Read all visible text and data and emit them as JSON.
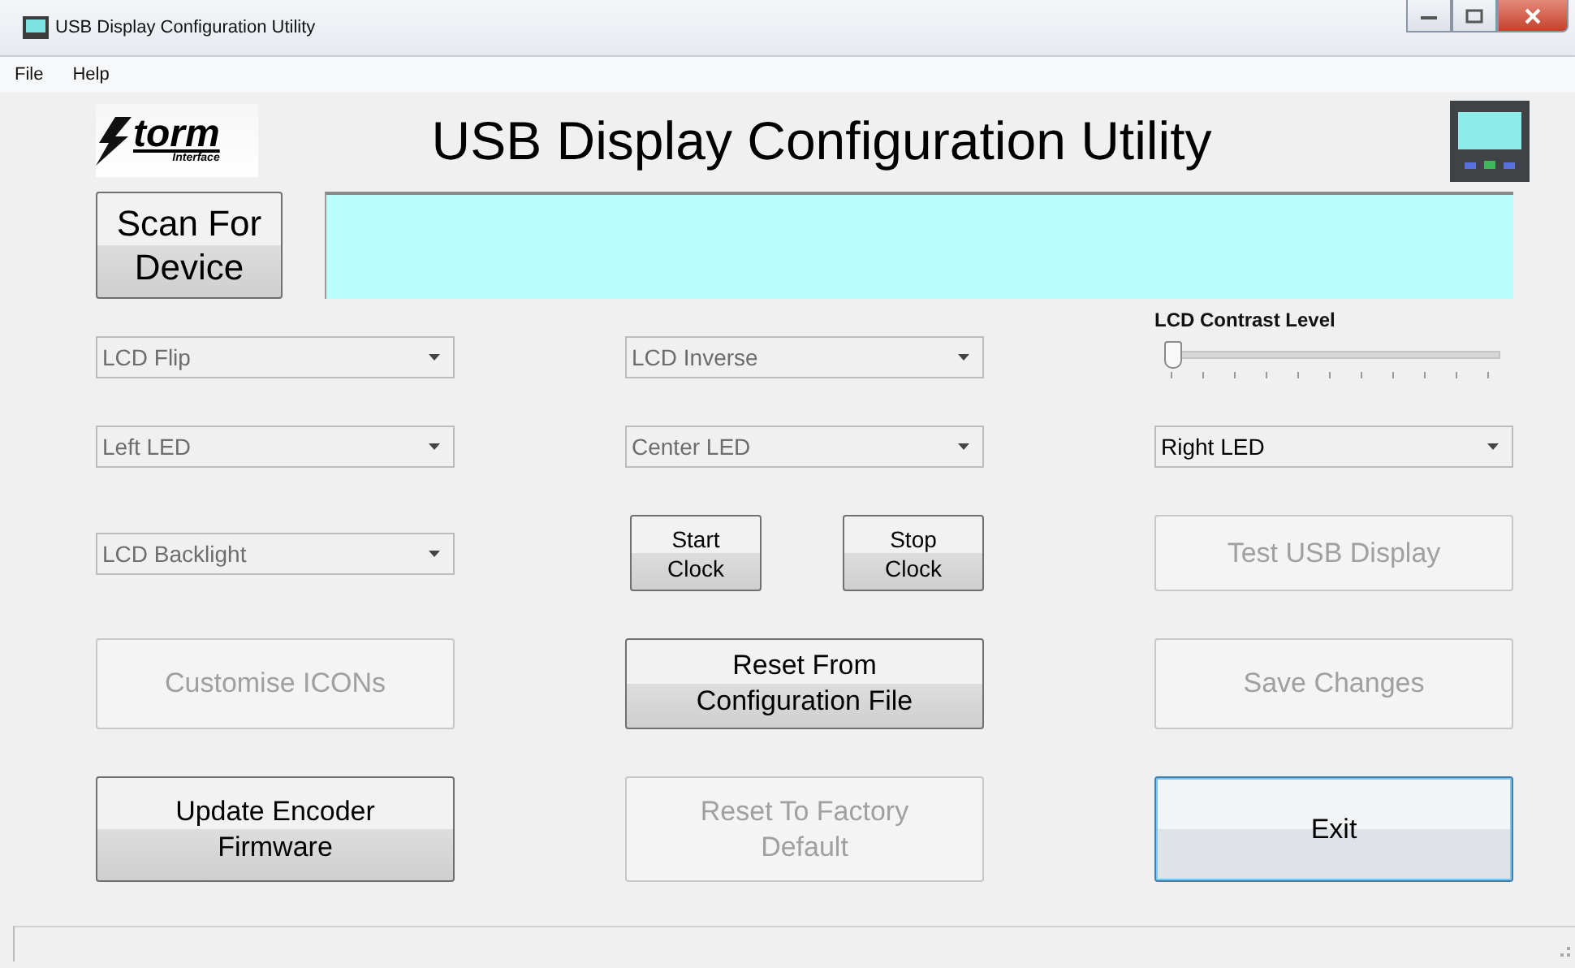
{
  "window": {
    "title": "USB Display Configuration Utility"
  },
  "menu": [
    "File",
    "Help"
  ],
  "header": {
    "logo_text": "torm",
    "logo_subtext": "Interface",
    "title": "USB Display Configuration Utility"
  },
  "scan_button": {
    "label": "Scan For Device"
  },
  "rows": [
    [
      {
        "kind": "dropdown",
        "label": "LCD Flip",
        "disabled": true
      },
      {
        "kind": "dropdown",
        "label": "LCD Inverse",
        "disabled": true
      },
      {
        "kind": "slider",
        "label": "LCD Contrast Level",
        "level": 0
      }
    ],
    [
      {
        "kind": "dropdown",
        "label": "Left LED",
        "disabled": true
      },
      {
        "kind": "dropdown",
        "label": "Center LED",
        "disabled": true
      },
      {
        "kind": "dropdown",
        "label": "Right LED",
        "disabled": false
      }
    ],
    [
      {
        "kind": "dropdown",
        "label": "LCD Backlight",
        "disabled": true
      },
      {
        "kind": "button_pair",
        "buttons": [
          {
            "label": "Start Clock",
            "disabled": false
          },
          {
            "label": "Stop Clock",
            "disabled": false
          }
        ]
      },
      {
        "kind": "button",
        "label": "Test USB Display",
        "disabled": true,
        "focused": false
      }
    ],
    [
      {
        "kind": "button",
        "label": "Customise ICONs",
        "disabled": true,
        "focused": false
      },
      {
        "kind": "button",
        "label": "Reset From Configuration File",
        "disabled": false,
        "focused": false
      },
      {
        "kind": "button",
        "label": "Save Changes",
        "disabled": true,
        "focused": false
      }
    ],
    [
      {
        "kind": "button",
        "label": "Update Encoder Firmware",
        "disabled": false,
        "focused": false
      },
      {
        "kind": "button",
        "label": "Reset To Factory Default",
        "disabled": true,
        "focused": false
      },
      {
        "kind": "button",
        "label": "Exit",
        "disabled": false,
        "focused": true
      }
    ]
  ]
}
